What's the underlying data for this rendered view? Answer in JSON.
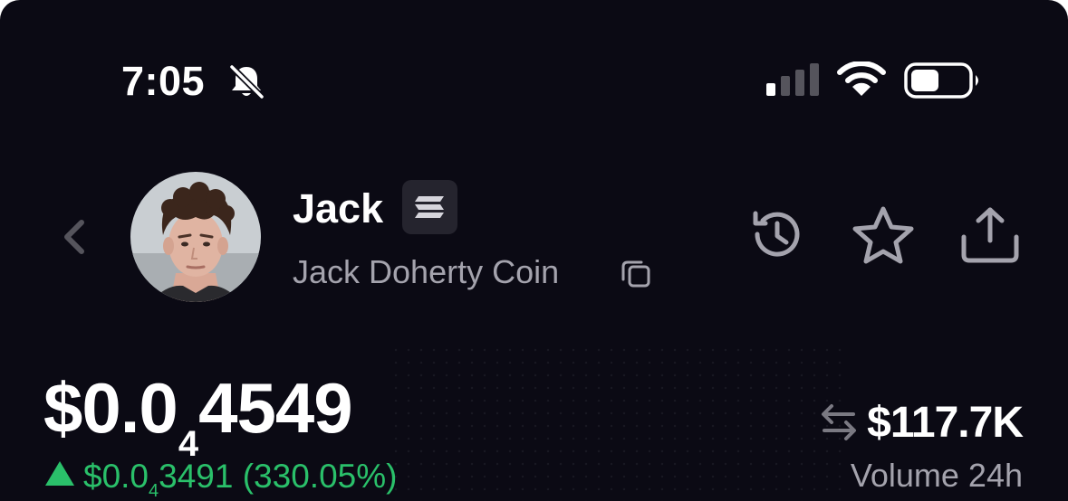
{
  "status_bar": {
    "time": "7:05",
    "icons": [
      "bell-slash-icon",
      "signal-icon",
      "wifi-icon",
      "battery-icon"
    ]
  },
  "token": {
    "name": "Jack",
    "full_name": "Jack Doherty Coin",
    "chain_icon": "solana-icon",
    "avatar": "avatar-photo"
  },
  "price": {
    "prefix": "$0.0",
    "zero_count": "4",
    "digits": "4549"
  },
  "change": {
    "direction": "up",
    "prefix": "$0.0",
    "zero_count": "4",
    "digits": "3491",
    "percent": "(330.05%)"
  },
  "volume": {
    "value": "$117.7K",
    "label": "Volume 24h"
  },
  "actions": [
    "back-icon",
    "history-icon",
    "star-icon",
    "share-icon",
    "copy-icon",
    "swap-icon"
  ],
  "colors": {
    "background": "#0b0a14",
    "positive": "#2ac06a",
    "muted_text": "#a4a3ad",
    "badge_bg": "#25242e"
  }
}
